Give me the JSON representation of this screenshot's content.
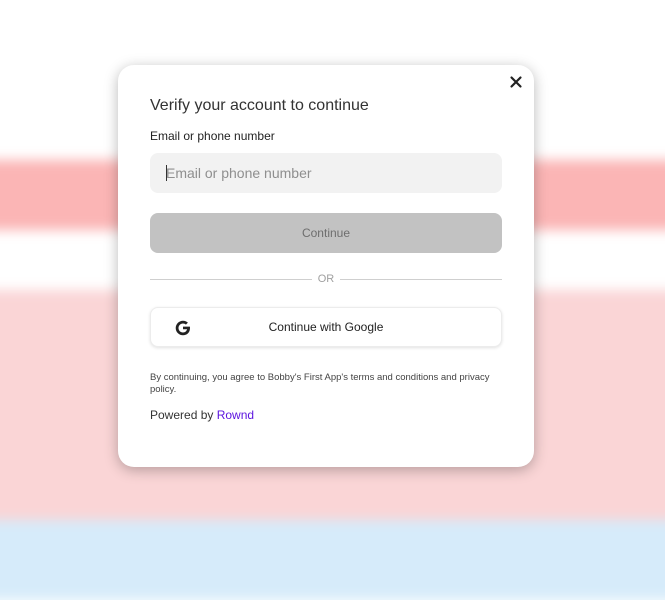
{
  "modal": {
    "title": "Verify your account to continue",
    "close_icon": "close-icon"
  },
  "form": {
    "field_label": "Email or phone number",
    "input_placeholder": "Email or phone number",
    "input_value": "",
    "continue_label": "Continue"
  },
  "divider": {
    "text": "OR"
  },
  "google": {
    "icon": "google-icon",
    "label": "Continue with Google"
  },
  "footer": {
    "terms": "By continuing, you agree to Bobby's First App's terms and conditions and privacy policy.",
    "powered_prefix": "Powered by",
    "powered_link": "Rownd"
  },
  "colors": {
    "link": "#5b13df",
    "button_disabled_bg": "#c2c2c2",
    "backdrop_red": "#fbb5b5",
    "backdrop_pink": "#fad5d6",
    "backdrop_blue": "#d6ebfa"
  }
}
